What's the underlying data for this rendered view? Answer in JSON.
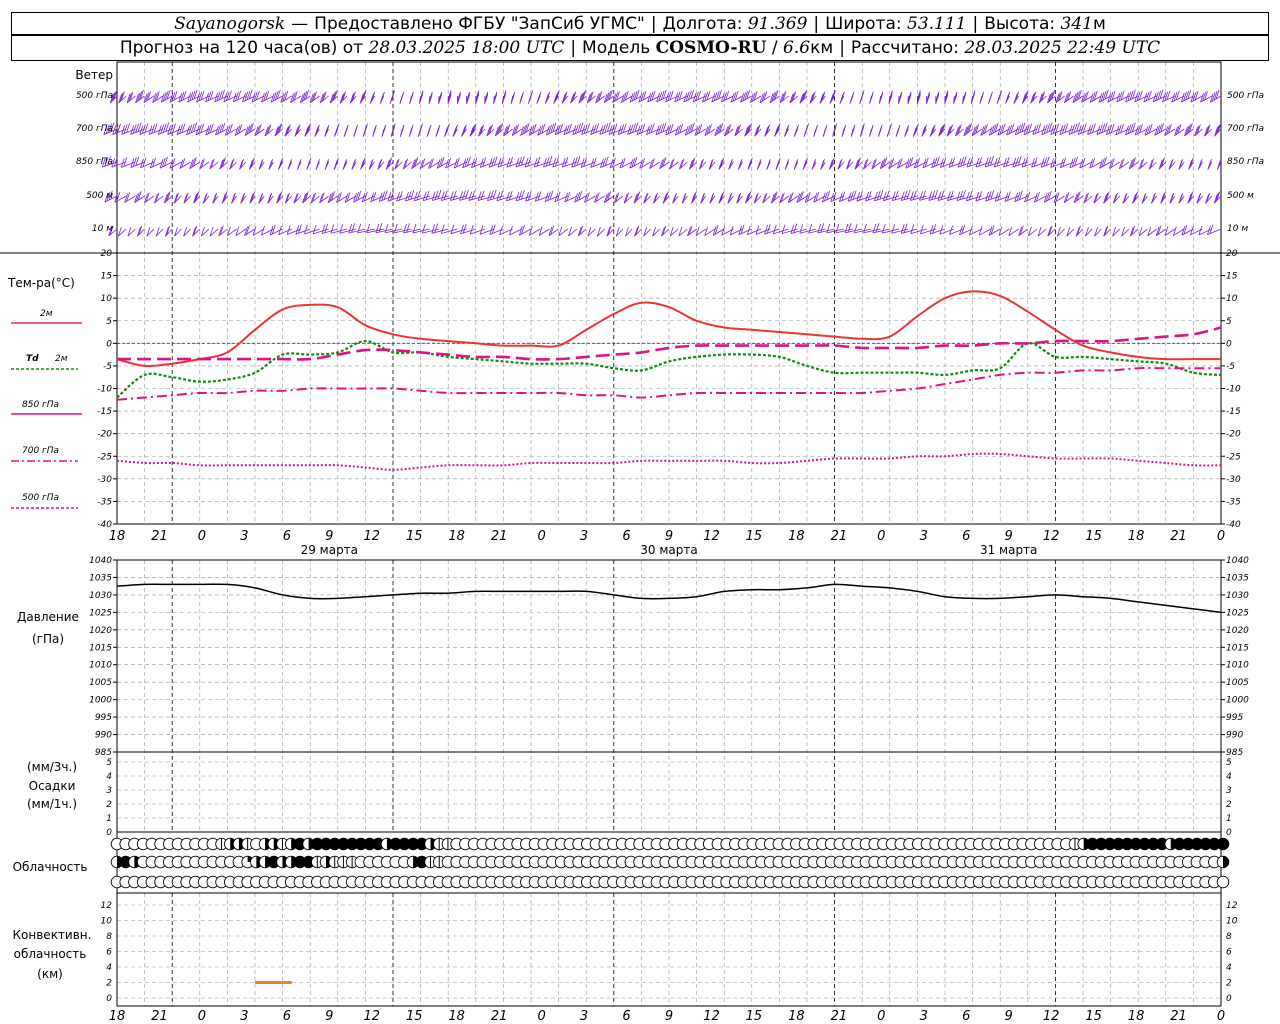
{
  "header": {
    "station": "Sayanogorsk",
    "dash": "—",
    "provider_label": "Предоставлено ФГБУ \"ЗапСиб УГМС\"",
    "lon_label": "Долгота:",
    "lon_value": "91.369",
    "lat_label": "Широта:",
    "lat_value": "53.111",
    "alt_label": "Высота:",
    "alt_value": "341",
    "alt_unit": "м",
    "forecast_label": "Прогноз на 120 часа(ов) от",
    "forecast_time": "28.03.2025 18:00 UTC",
    "model_label": "Модель",
    "model_name": "COSMO-RU",
    "model_res": "6.6",
    "model_res_unit": "км",
    "computed_label": "Рассчитано:",
    "computed_time": "28.03.2025 22:49 UTC"
  },
  "labels": {
    "wind": "Ветер",
    "wind_levels": [
      "500 гПа",
      "700 гПа",
      "850 гПа",
      "500 м",
      "10 м"
    ],
    "temp_title": "Тем-ра(°С)",
    "t2m": "2м",
    "td": "Td",
    "td2m": "2м",
    "t850": "850 гПа",
    "t700": "700 гПа",
    "t500": "500 гПа",
    "pressure": "Давление",
    "pressure_unit": "(гПа)",
    "precip_unit3": "(мм/3ч.)",
    "precip": "Осадки",
    "precip_unit1": "(мм/1ч.)",
    "cloud": "Облачность",
    "conv1": "Конвективн.",
    "conv2": "облачность",
    "conv_unit": "(км)"
  },
  "x_ticks": [
    "18",
    "21",
    "0",
    "3",
    "6",
    "9",
    "12",
    "15",
    "18",
    "21",
    "0",
    "3",
    "6",
    "9",
    "12",
    "15",
    "18",
    "21",
    "0",
    "3",
    "6",
    "9",
    "12",
    "15",
    "18",
    "21",
    "0"
  ],
  "day_labels": [
    "29 марта",
    "30 марта",
    "31 марта"
  ],
  "colors": {
    "t2m": "#ee3333",
    "td": "#118811",
    "t850": "#dd1188",
    "t700": "#dd1188",
    "t500": "#dd1188",
    "wind": "#7a1fd0",
    "pressure": "#000000",
    "conv": "#e08830",
    "zero_line": "#3333cc",
    "grid": "#999999"
  },
  "chart_data": [
    {
      "type": "line",
      "title": "Тем-ра(°С)",
      "x_hours_from_start": [
        0,
        3,
        6,
        9,
        12,
        15,
        18,
        21,
        24,
        27,
        30,
        33,
        36,
        39,
        42,
        45,
        48,
        51,
        54,
        57,
        60,
        63,
        66,
        69,
        72,
        75,
        78,
        81,
        84,
        87,
        90,
        93,
        96,
        99,
        102,
        105,
        108,
        111,
        114,
        117,
        120
      ],
      "ylim": [
        -40,
        20
      ],
      "series": [
        {
          "name": "2м",
          "values": [
            -3.5,
            -5,
            -4.5,
            -3.5,
            -2,
            3,
            7.5,
            8.5,
            8,
            4,
            2,
            1,
            0.5,
            0,
            -0.5,
            -0.5,
            -0.5,
            3,
            6.5,
            9,
            8,
            5,
            3.5,
            3,
            2.5,
            2,
            1.5,
            1,
            1.5,
            6,
            10,
            11.5,
            10.5,
            7,
            3,
            -0.5,
            -2,
            -3,
            -3.5,
            -3.5,
            -3.5
          ]
        },
        {
          "name": "Td 2м",
          "values": [
            -12,
            -7,
            -7.5,
            -8.5,
            -8,
            -6.5,
            -2.5,
            -2.5,
            -2,
            0.5,
            -2,
            -2,
            -3,
            -3.5,
            -4,
            -4.5,
            -4.5,
            -4.5,
            -5.5,
            -6,
            -4,
            -3,
            -2.5,
            -2.5,
            -3,
            -5,
            -6.5,
            -6.5,
            -6.5,
            -6.5,
            -7,
            -6,
            -5.5,
            0,
            -3,
            -3,
            -3.5,
            -4,
            -4.5,
            -6.5,
            -7
          ]
        },
        {
          "name": "850 гПа",
          "values": [
            -3.5,
            -3.5,
            -3.5,
            -3.5,
            -3.5,
            -3.5,
            -3.5,
            -3.5,
            -2.5,
            -1.5,
            -1.5,
            -2,
            -2.5,
            -3,
            -3,
            -3.5,
            -3.5,
            -3,
            -2.5,
            -2,
            -1,
            -0.5,
            -0.5,
            -0.5,
            -0.5,
            -0.5,
            -0.5,
            -1,
            -1,
            -1,
            -0.5,
            -0.5,
            0,
            0,
            0.5,
            0.5,
            0.5,
            1,
            1.5,
            2,
            3.5
          ]
        },
        {
          "name": "700 гПа",
          "values": [
            -12.5,
            -12,
            -11.5,
            -11,
            -11,
            -10.5,
            -10.5,
            -10,
            -10,
            -10,
            -10,
            -10.5,
            -11,
            -11,
            -11,
            -11,
            -11,
            -11.5,
            -11.5,
            -12,
            -11.5,
            -11,
            -11,
            -11,
            -11,
            -11,
            -11,
            -11,
            -10.5,
            -10,
            -9,
            -8,
            -7,
            -6.5,
            -6.5,
            -6,
            -6,
            -5.5,
            -5.5,
            -5.5,
            -5.5
          ]
        },
        {
          "name": "500 гПа",
          "values": [
            -26,
            -26.5,
            -26.5,
            -27,
            -27,
            -27,
            -27,
            -27,
            -27,
            -27.5,
            -28,
            -27.5,
            -27,
            -27,
            -27,
            -26.5,
            -26.5,
            -26.5,
            -26.5,
            -26,
            -26,
            -26,
            -26,
            -26.5,
            -26.5,
            -26,
            -25.5,
            -25.5,
            -25.5,
            -25,
            -25,
            -24.5,
            -24.5,
            -25,
            -25.5,
            -25.5,
            -25.5,
            -26,
            -26.5,
            -27,
            -27
          ]
        }
      ]
    },
    {
      "type": "line",
      "title": "Давление",
      "x_hours_from_start": [
        0,
        3,
        6,
        9,
        12,
        15,
        18,
        21,
        24,
        27,
        30,
        33,
        36,
        39,
        42,
        45,
        48,
        51,
        54,
        57,
        60,
        63,
        66,
        69,
        72,
        75,
        78,
        81,
        84,
        87,
        90,
        93,
        96,
        99,
        102,
        105,
        108,
        111,
        114,
        117,
        120
      ],
      "ylim": [
        985,
        1040
      ],
      "ylabel": "(гПа)",
      "series": [
        {
          "name": "Давление",
          "values": [
            1032.5,
            1033,
            1033,
            1033,
            1033,
            1032,
            1030,
            1029,
            1029,
            1029.5,
            1030,
            1030.5,
            1030.5,
            1031,
            1031,
            1031,
            1031,
            1031,
            1030,
            1029,
            1029,
            1029.5,
            1031,
            1031.5,
            1031.5,
            1032,
            1033,
            1032.5,
            1032,
            1031,
            1029.5,
            1029,
            1029,
            1029.5,
            1030,
            1029.5,
            1029,
            1028,
            1027,
            1026,
            1025
          ]
        }
      ]
    },
    {
      "type": "bar",
      "title": "Осадки",
      "ylim": [
        0,
        5
      ],
      "series": [
        {
          "values": []
        }
      ]
    },
    {
      "type": "line",
      "title": "Конвективн. облачность",
      "ylim": [
        0,
        13
      ],
      "ylabel": "(км)",
      "series": [
        {
          "x_hours_from_start": [
            15,
            19
          ],
          "values": [
            2,
            2
          ]
        }
      ]
    }
  ],
  "cloud_rows": [
    "00000000000034430443454555555554555543300000000000000000000000000000000000000000000000000000000000000000000000345555555554555555",
    "45400000000000024454455343330000004533000000000000000000000000000000000000000000000000000000000000000000000000000000000000000004",
    "00000000000000000000000000000000000000000000000000000000000000000000000000000000000000000000000000000000000000000000000000000000"
  ]
}
